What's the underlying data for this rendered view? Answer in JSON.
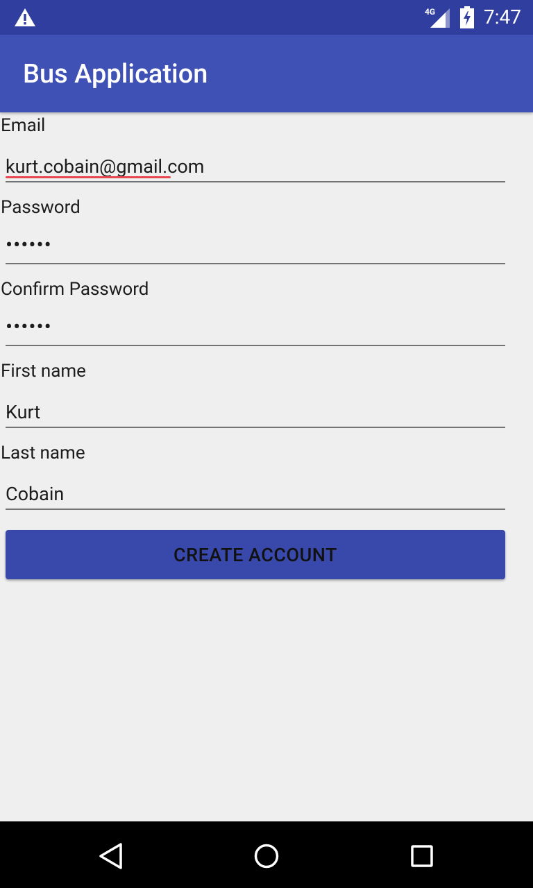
{
  "status_bar": {
    "network_label": "4G",
    "time": "7:47",
    "icons": [
      "warning-icon",
      "signal-icon",
      "battery-charging-icon"
    ]
  },
  "app_bar": {
    "title": "Bus Application"
  },
  "form": {
    "email": {
      "label": "Email",
      "value": "kurt.cobain@gmail.com"
    },
    "password": {
      "label": "Password",
      "value": "••••••"
    },
    "confirm_password": {
      "label": "Confirm Password",
      "value": "••••••"
    },
    "first_name": {
      "label": "First name",
      "value": "Kurt"
    },
    "last_name": {
      "label": "Last name",
      "value": "Cobain"
    }
  },
  "create_account_label": "CREATE ACCOUNT",
  "nav_bar": {
    "icons": [
      "back-icon",
      "home-icon",
      "recents-icon"
    ]
  },
  "colors": {
    "status_bar": "#303f9f",
    "app_bar": "#3f51b5",
    "button": "#3949ab",
    "background": "#efefef",
    "spellcheck": "#e8474e"
  }
}
